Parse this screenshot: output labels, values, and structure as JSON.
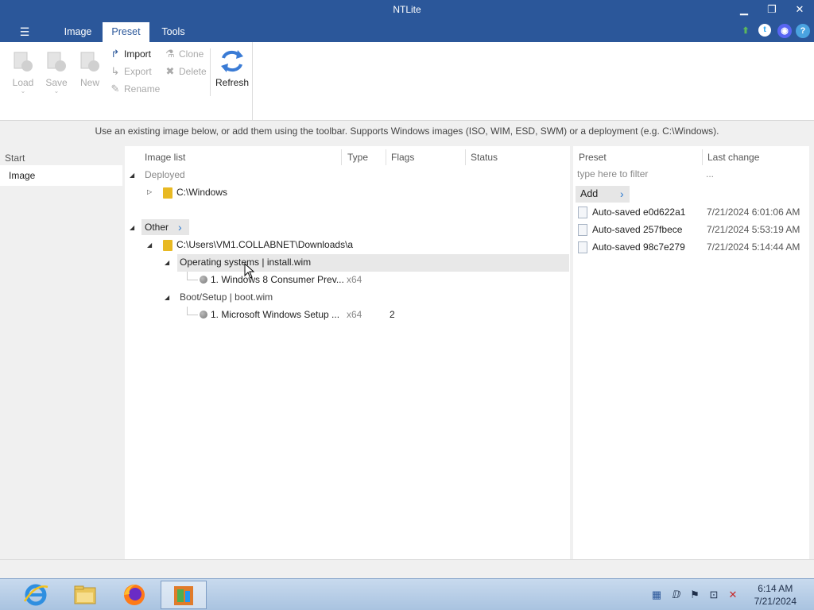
{
  "window": {
    "title": "NTLite",
    "minimize": "▁",
    "restore": "❐",
    "close": "✕"
  },
  "menu": {
    "icon": "hamburger-icon",
    "glyph": "☰"
  },
  "tabs": [
    {
      "label": "Image",
      "active": false
    },
    {
      "label": "Preset",
      "active": true
    },
    {
      "label": "Tools",
      "active": false
    }
  ],
  "top_icons": [
    "update-arrow-icon",
    "twitter-icon",
    "discord-icon",
    "help-icon"
  ],
  "ribbon": {
    "load": "Load",
    "save": "Save",
    "new": "New",
    "import": "Import",
    "export": "Export",
    "rename": "Rename",
    "clone": "Clone",
    "delete": "Delete",
    "refresh": "Refresh"
  },
  "info_text": "Use an existing image below, or add them using the toolbar. Supports Windows images (ISO, WIM, ESD, SWM) or a deployment (e.g. C:\\Windows).",
  "leftnav": {
    "header": "Start",
    "item": "Image"
  },
  "image_list": {
    "columns": [
      "Image list",
      "Type",
      "Flags",
      "Status"
    ],
    "deployed_label": "Deployed",
    "deployed_path": "C:\\Windows",
    "other_label": "Other",
    "other_path": "C:\\Users\\VM1.COLLABNET\\Downloads\\a",
    "group1": "Operating systems  |  install.wim",
    "group1_item": "1. Windows 8 Consumer Prev...",
    "group1_type": "x64",
    "group2": "Boot/Setup  |  boot.wim",
    "group2_item": "1. Microsoft Windows Setup ...",
    "group2_type": "x64",
    "group2_flags": "2"
  },
  "presets": {
    "columns": [
      "Preset",
      "Last change"
    ],
    "filter_placeholder": "type here to filter",
    "filter_more": "...",
    "add_label": "Add",
    "rows": [
      {
        "name": "Auto-saved e0d622a1",
        "date": "7/21/2024 6:01:06 AM"
      },
      {
        "name": "Auto-saved 257fbece",
        "date": "7/21/2024 5:53:19 AM"
      },
      {
        "name": "Auto-saved 98c7e279",
        "date": "7/21/2024 5:14:44 AM"
      }
    ]
  },
  "taskbar": {
    "apps": [
      "internet-explorer-icon",
      "file-explorer-icon",
      "firefox-icon",
      "ntlite-icon"
    ],
    "time": "6:14 AM",
    "date": "7/21/2024"
  },
  "colors": {
    "titlebar": "#2b579a",
    "accent": "#2b579a"
  }
}
